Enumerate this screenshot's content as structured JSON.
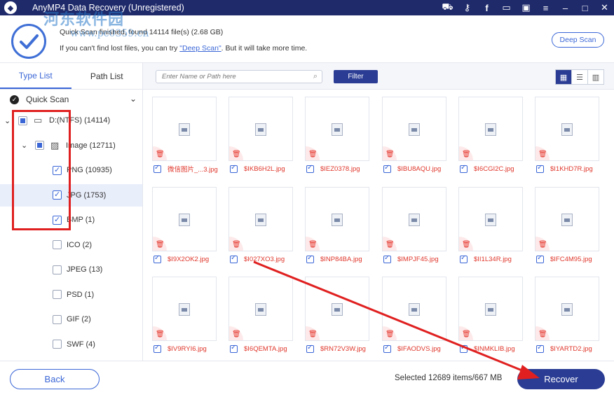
{
  "window": {
    "title": "AnyMP4 Data Recovery (Unregistered)",
    "icons": [
      "cart-icon",
      "key-icon",
      "facebook-icon",
      "chat-icon",
      "save-icon",
      "menu-icon",
      "minimize-icon",
      "maximize-icon",
      "close-icon"
    ]
  },
  "watermark": {
    "text": "河东软件园",
    "url": "www.pc0359.cn"
  },
  "info": {
    "line1": "Quick Scan finished, found 14114 file(s) (2.68 GB)",
    "line2_prefix": "If you can't find lost files, you can try ",
    "line2_link": "\"Deep Scan\"",
    "line2_suffix": ". But it will take more time.",
    "deep_scan_button": "Deep Scan"
  },
  "sidebar": {
    "tabs": [
      {
        "label": "Type List",
        "active": true
      },
      {
        "label": "Path List",
        "active": false
      }
    ],
    "scan_mode": "Quick Scan",
    "tree": [
      {
        "label": "D:(NTFS) (14114)",
        "level": 0,
        "state": "partial",
        "icon": "drive-icon",
        "expanded": true
      },
      {
        "label": "Image (12711)",
        "level": 1,
        "state": "partial",
        "icon": "image-icon",
        "expanded": true
      },
      {
        "label": "PNG (10935)",
        "level": 2,
        "state": "checked"
      },
      {
        "label": "JPG (1753)",
        "level": 2,
        "state": "checked",
        "selected": true
      },
      {
        "label": "BMP (1)",
        "level": 2,
        "state": "checked"
      },
      {
        "label": "ICO (2)",
        "level": 2,
        "state": "unchecked"
      },
      {
        "label": "JPEG (13)",
        "level": 2,
        "state": "unchecked"
      },
      {
        "label": "PSD (1)",
        "level": 2,
        "state": "unchecked"
      },
      {
        "label": "GIF (2)",
        "level": 2,
        "state": "unchecked"
      },
      {
        "label": "SWF (4)",
        "level": 2,
        "state": "unchecked"
      }
    ]
  },
  "toolbar": {
    "search_placeholder": "Enter Name or Path here",
    "filter_label": "Filter",
    "view_modes": [
      "grid-view-icon",
      "list-view-icon",
      "detail-view-icon"
    ]
  },
  "files": [
    "微信图片_...3.jpg",
    "$IKB6H2L.jpg",
    "$IEZ0378.jpg",
    "$IBU8AQU.jpg",
    "$I6CGI2C.jpg",
    "$I1KHD7R.jpg",
    "$I9X2OK2.jpg",
    "$I027XO3.jpg",
    "$INP84BA.jpg",
    "$IMPJF45.jpg",
    "$II1L34R.jpg",
    "$IFC4M95.jpg",
    "$IV9RYI6.jpg",
    "$I6QEMTA.jpg",
    "$RN72V3W.jpg",
    "$IFAODVS.jpg",
    "$INMKLIB.jpg",
    "$IYARTD2.jpg"
  ],
  "footer": {
    "back_label": "Back",
    "selected_text": "Selected 12689 items/667 MB",
    "recover_label": "Recover"
  },
  "colors": {
    "accent": "#3a66d6",
    "dark_navy": "#1f2a6b",
    "file_name": "#e0372c",
    "annotation": "#e02020"
  }
}
